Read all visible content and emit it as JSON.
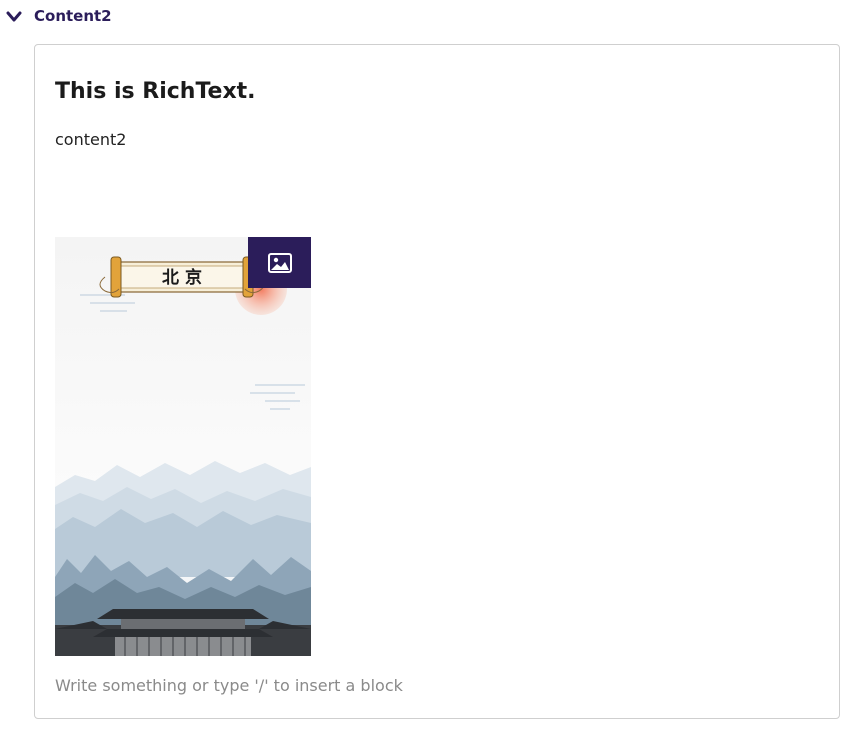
{
  "section": {
    "title": "Content2",
    "expanded": true
  },
  "editor": {
    "heading": "This is RichText.",
    "paragraph": "content2",
    "placeholder": "Write something or type '/' to insert a block"
  },
  "image": {
    "scroll_text": "北 京",
    "image_button_icon": "image-icon"
  },
  "colors": {
    "accent": "#2b1d5a",
    "border": "#cfcfcf",
    "placeholder": "#8a8a8a"
  }
}
